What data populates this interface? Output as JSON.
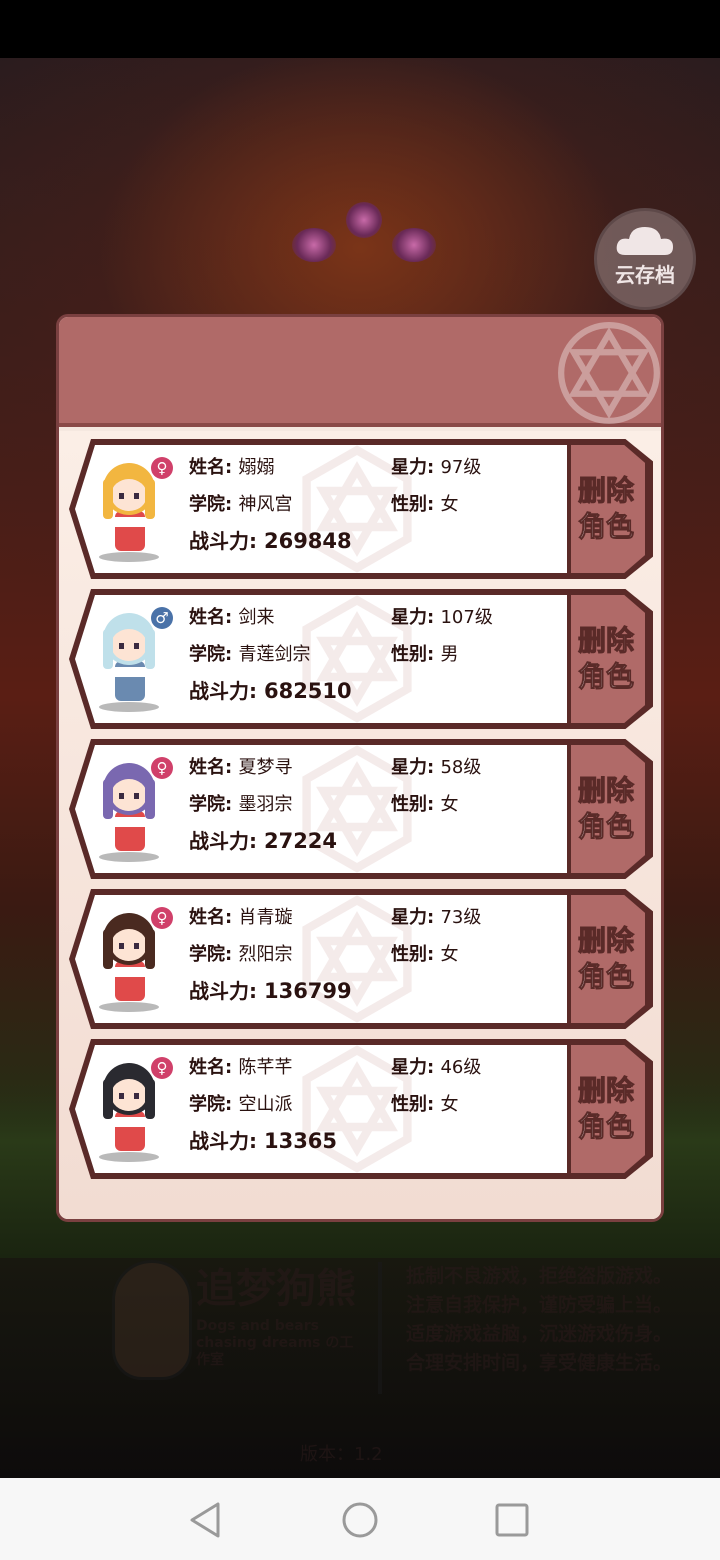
{
  "background": {
    "cloud_save_label": "云存档",
    "studio": {
      "name": "追梦狗熊",
      "subtitle": "Dogs and bears chasing dreams の工作室",
      "advisory_lines": [
        "抵制不良游戏，拒绝盗版游戏。",
        "注意自我保护，谨防受骗上当。",
        "适度游戏益脑，沉迷游戏伤身。",
        "合理安排时间，享受健康生活。"
      ]
    },
    "version": "版本：1.2"
  },
  "labels": {
    "name": "姓名:",
    "academy": "学院:",
    "power": "战斗力:",
    "star": "星力:",
    "gender": "性别:",
    "delete": "删除角色"
  },
  "characters": [
    {
      "name": "嫋嫋",
      "academy": "神风宫",
      "power": "269848",
      "star_level": "97级",
      "gender": "女",
      "gender_icon": "female-icon",
      "hair_color": "#f2b640"
    },
    {
      "name": "剑来",
      "academy": "青莲剑宗",
      "power": "682510",
      "star_level": "107级",
      "gender": "男",
      "gender_icon": "male-icon",
      "hair_color": "#bfe0ea"
    },
    {
      "name": "夏梦寻",
      "academy": "墨羽宗",
      "power": "27224",
      "star_level": "58级",
      "gender": "女",
      "gender_icon": "female-icon",
      "hair_color": "#7a68b0"
    },
    {
      "name": "肖青璇",
      "academy": "烈阳宗",
      "power": "136799",
      "star_level": "73级",
      "gender": "女",
      "gender_icon": "female-icon",
      "hair_color": "#4a2a20"
    },
    {
      "name": "陈芊芊",
      "academy": "空山派",
      "power": "13365",
      "star_level": "46级",
      "gender": "女",
      "gender_icon": "female-icon",
      "hair_color": "#2a2a30"
    }
  ],
  "colors": {
    "frame_dark": "#5a2a28",
    "frame_accent": "#b06a68",
    "female_icon": "#d0406a",
    "male_icon": "#4a72a8"
  }
}
